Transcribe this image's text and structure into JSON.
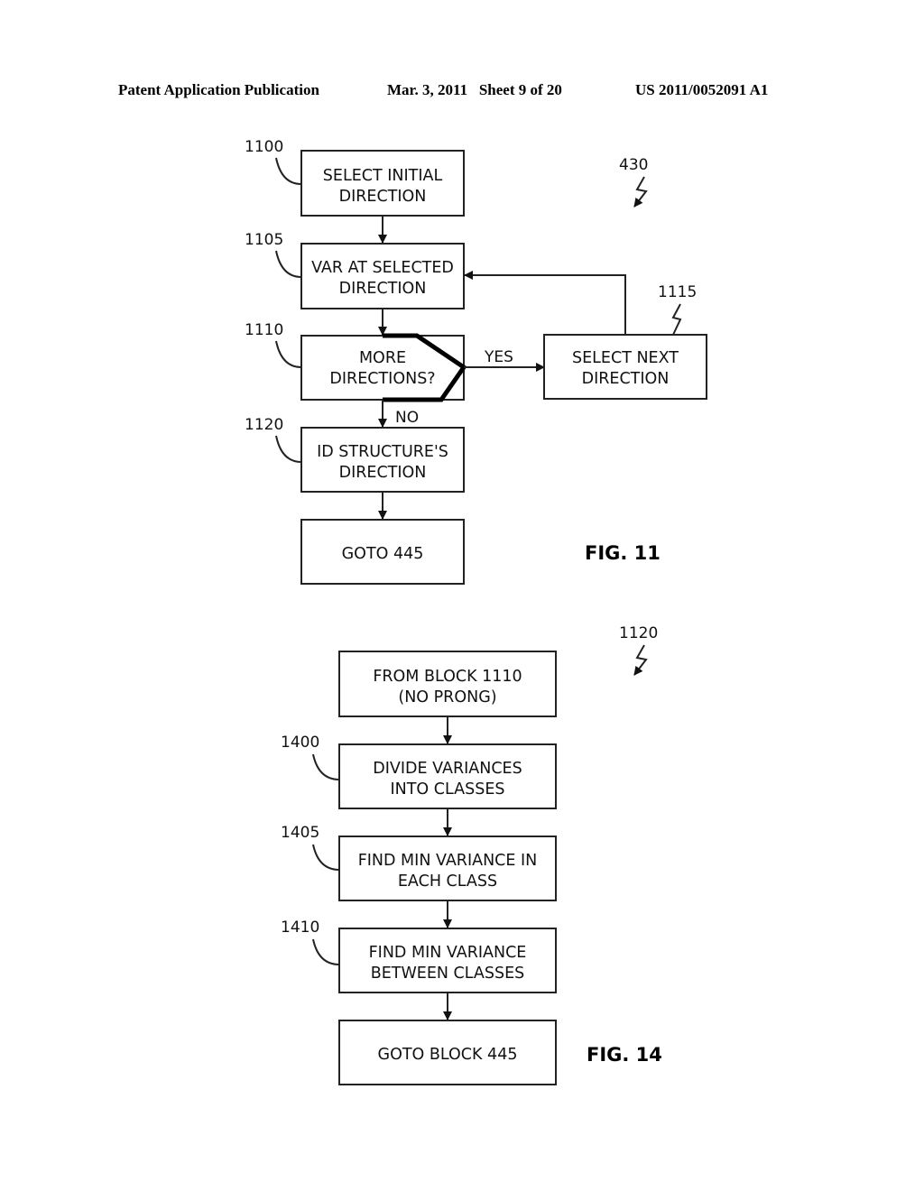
{
  "header": {
    "publication": "Patent Application Publication",
    "date_sheet": "Mar. 3, 2011   Sheet 9 of 20",
    "patent_number": "US 2011/0052091 A1"
  },
  "fig11": {
    "ref": "430",
    "caption": "FIG. 11",
    "steps": [
      {
        "ref": "1100",
        "line1": "SELECT INITIAL",
        "line2": "DIRECTION"
      },
      {
        "ref": "1105",
        "line1": "VAR AT SELECTED",
        "line2": "DIRECTION"
      },
      {
        "ref": "1110",
        "line1": "MORE",
        "line2": "DIRECTIONS?"
      },
      {
        "ref": "1120",
        "line1": "ID STRUCTURE'S",
        "line2": "DIRECTION"
      },
      {
        "ref": "",
        "line1": "GOTO 445",
        "line2": ""
      }
    ],
    "side_step": {
      "ref": "1115",
      "line1": "SELECT NEXT",
      "line2": "DIRECTION"
    },
    "yes_label": "YES",
    "no_label": "NO"
  },
  "fig14": {
    "ref": "1120",
    "caption": "FIG. 14",
    "steps": [
      {
        "ref": "",
        "line1": "FROM BLOCK 1110",
        "line2": "(NO PRONG)"
      },
      {
        "ref": "1400",
        "line1": "DIVIDE VARIANCES",
        "line2": "INTO CLASSES"
      },
      {
        "ref": "1405",
        "line1": "FIND MIN VARIANCE IN",
        "line2": "EACH CLASS"
      },
      {
        "ref": "1410",
        "line1": "FIND MIN VARIANCE",
        "line2": "BETWEEN CLASSES"
      },
      {
        "ref": "",
        "line1": "GOTO BLOCK 445",
        "line2": ""
      }
    ]
  }
}
